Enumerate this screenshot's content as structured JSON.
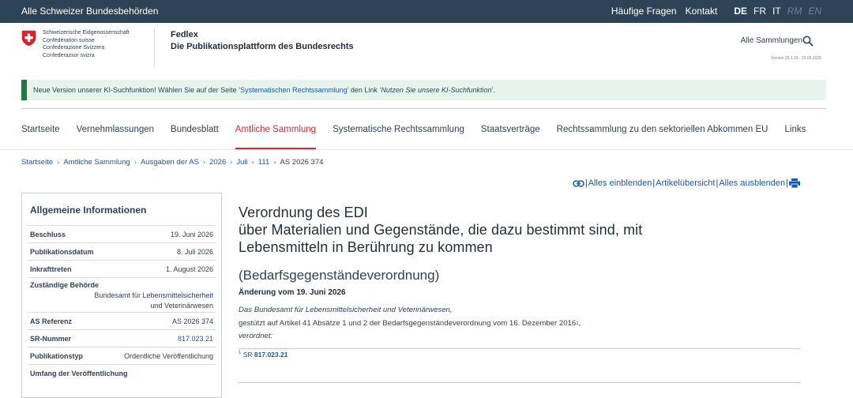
{
  "topbar": {
    "all_authorities": "Alle Schweizer Bundesbehörden",
    "faq": "Häufige Fragen",
    "contact": "Kontakt",
    "languages": [
      "DE",
      "FR",
      "IT",
      "RM",
      "EN"
    ]
  },
  "header": {
    "confederation_lines": [
      "Schweizerische Eidgenossenschaft",
      "Confédération suisse",
      "Confederazione Svizzera",
      "Confederaziun svizra"
    ],
    "app_name": "Fedlex",
    "app_subtitle": "Die Publikationsplattform des Bundesrechts",
    "collections": "Alle Sammlungen",
    "version": "Version 26.1.19 - 23.06.2026"
  },
  "notice": {
    "text_before": "Neue Version unserer KI-Suchfunktion! Wählen Sie auf der Seite ‘",
    "link": "Systematischen Rechtssammlung",
    "text_mid": "’ den Link ‘",
    "italic": "Nutzen Sie unsere KI-Suchfunktion",
    "text_after": "’."
  },
  "nav": [
    "Startseite",
    "Vernehmlassungen",
    "Bundesblatt",
    "Amtliche Sammlung",
    "Systematische Rechtssammlung",
    "Staatsverträge",
    "Rechtssammlung zu den sektoriellen Abkommen EU",
    "Links"
  ],
  "nav_active": "Amtliche Sammlung",
  "breadcrumb": [
    "Startseite",
    "Amtliche Sammlung",
    "Ausgaben der AS",
    "2026",
    "Juli",
    "111",
    "AS 2026 374"
  ],
  "tools": {
    "expand_all": "Alles einblenden",
    "article_overview": "Artikelübersicht",
    "collapse_all": "Alles ausblenden"
  },
  "sidebar": {
    "title": "Allgemeine Informationen",
    "rows": [
      {
        "key": "Beschluss",
        "value": "19. Juni 2026"
      },
      {
        "key": "Publikationsdatum",
        "value": "8. Juli 2026"
      },
      {
        "key": "Inkrafttreten",
        "value": "1. August 2026"
      },
      {
        "key": "Zuständige Behörde",
        "value": "Bundesamt für Lebensmittelsicherheit und Veterinärwesen"
      },
      {
        "key": "AS Referenz",
        "value": "AS 2026 374"
      },
      {
        "key": "SR-Nummer",
        "value": "817.023.21"
      },
      {
        "key": "Publikationstyp",
        "value": "Ordentliche Veröffentlichung"
      },
      {
        "key": "Umfang der Veröffentlichung",
        "value": ""
      }
    ]
  },
  "document": {
    "title_lines": [
      "Verordnung des EDI",
      "über Materialien und Gegenstände, die dazu bestimmt sind, mit",
      "Lebensmitteln in Berührung zu kommen"
    ],
    "abbreviation": "(Bedarfsgegenständeverordnung)",
    "amendment": "Änderung vom 19. Juni 2026",
    "preamble_1": "Das Bundesamt für Lebensmittelsicherheit und Veterinärwesen,",
    "preamble_2": "gestützt auf Artikel 41 Absätze 1 und 2 der Bedarfsgegenständeverordnung vom 16. Dezember 2016",
    "preamble_2_sup": "1",
    "preamble_2_end": ",",
    "preamble_3": "verordnet:",
    "footnote_num": "1",
    "footnote_sr": "SR",
    "footnote_ref": "817.023.21"
  },
  "colors": {
    "topbar": "#2f4356",
    "active_red": "#c8303e",
    "link_blue": "#1a5aa6",
    "notice_bg": "#e6f4ec",
    "notice_green": "#1c7a45"
  }
}
